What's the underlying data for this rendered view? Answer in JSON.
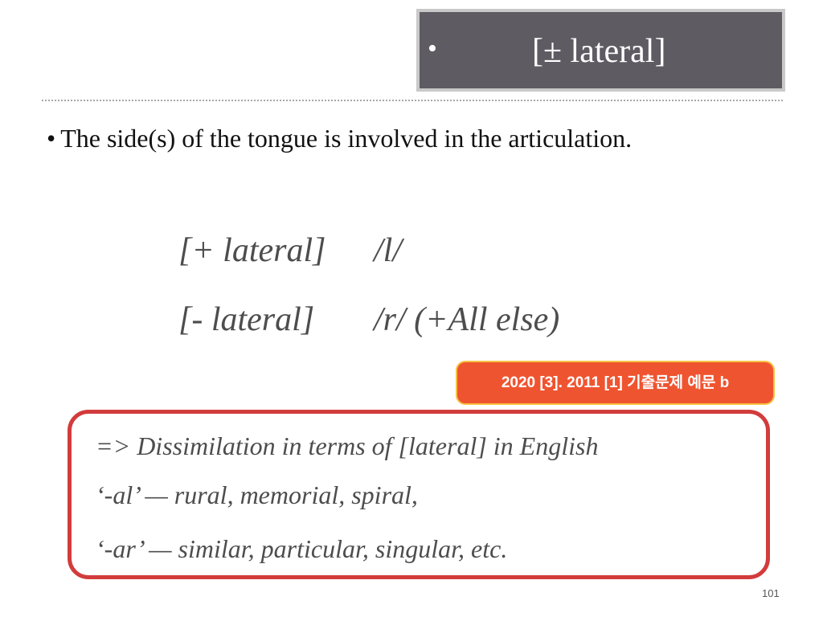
{
  "header": {
    "bullet": "•",
    "title": "[± lateral]"
  },
  "bullets": [
    "The side(s) of the tongue is involved in the articulation."
  ],
  "features": [
    {
      "label": "[+ lateral]",
      "segments": "/l/"
    },
    {
      "label": "[- lateral]",
      "segments": "/r/ (+All else)"
    }
  ],
  "badge": "2020 [3]. 2011 [1] 기출문제 예문 b",
  "example_box": {
    "lines": [
      "=> Dissimilation in terms of [lateral] in English",
      "‘-al’ — rural, memorial, spiral,",
      "‘-ar’ — similar, particular, singular, etc."
    ]
  },
  "page_number": "101",
  "colors": {
    "title_bg": "#5f5b63",
    "badge_bg": "#ef5430",
    "badge_border": "#f7c243",
    "box_border": "#d23c3c"
  }
}
